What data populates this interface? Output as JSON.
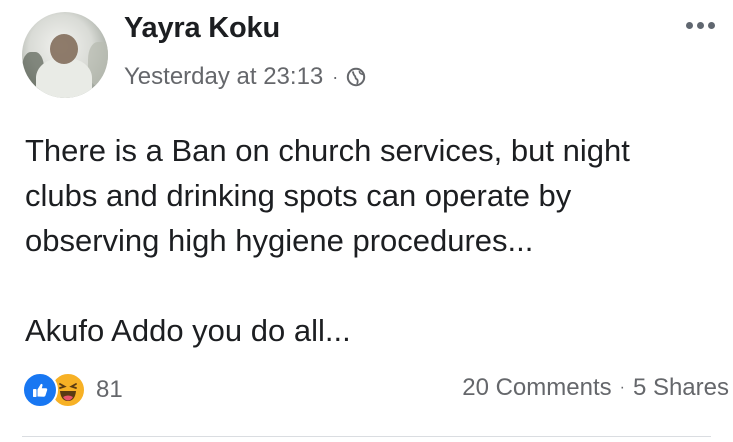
{
  "post": {
    "author": "Yayra Koku",
    "timestamp": "Yesterday at 23:13",
    "separator": "·",
    "privacy_icon": "globe-icon",
    "more_icon": "more-options-icon",
    "body_lines": [
      "There is a Ban on church services, but night",
      "clubs and drinking spots can operate by",
      "observing high hygiene procedures...",
      "Akufo Addo you do all..."
    ]
  },
  "reactions": {
    "icons": [
      "like-icon",
      "haha-icon"
    ],
    "count": "81"
  },
  "stats": {
    "comments": "20 Comments",
    "separator": "·",
    "shares": "5 Shares"
  },
  "colors": {
    "like_blue": "#1877f2",
    "haha_yellow": "#f7b125",
    "meta_gray": "#65676b",
    "text": "#1c1e21"
  }
}
